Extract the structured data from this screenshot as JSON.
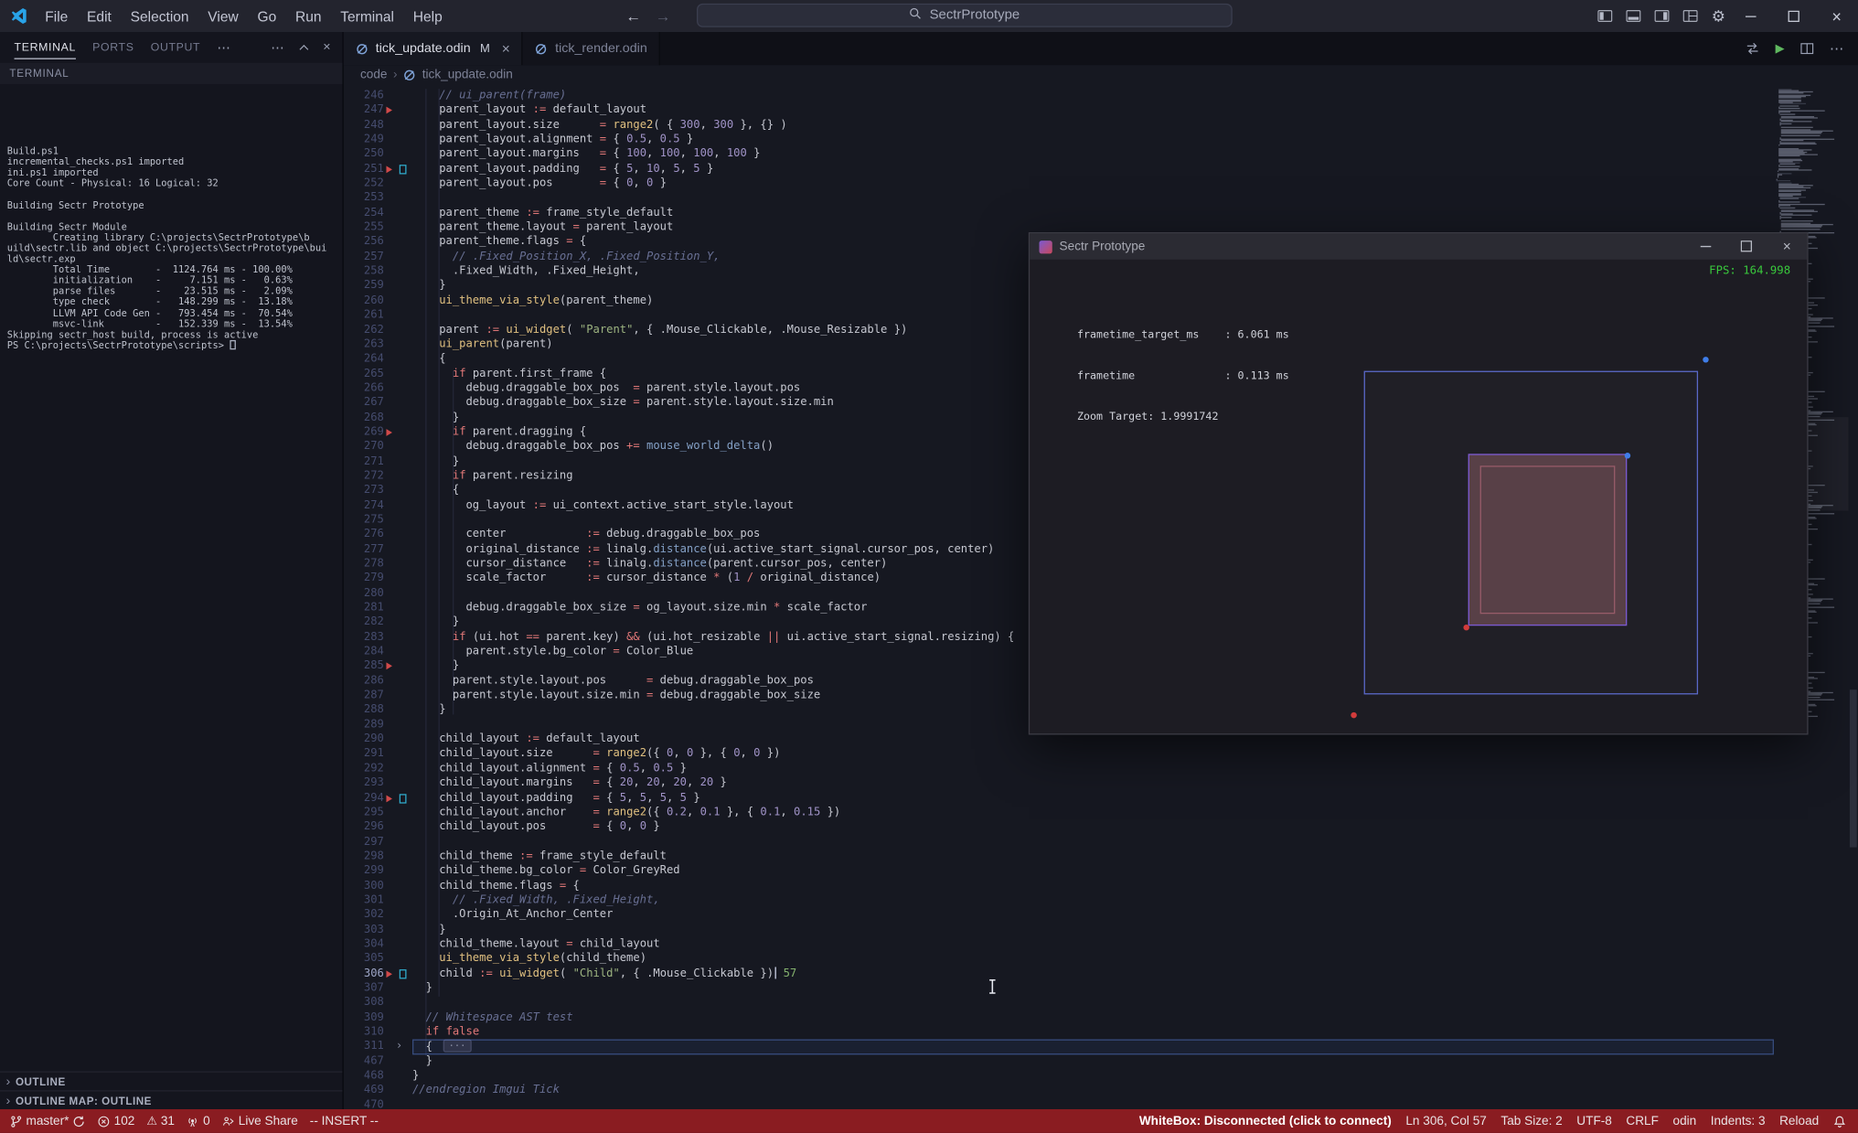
{
  "colors": {
    "editor_bg": "#161821",
    "panel_bg": "#14151e",
    "titlebar_bg": "#23242e",
    "tabbar_bg": "#0f1017",
    "statusbar_bg": "#8a1c21",
    "keyword_red": "#e27878",
    "number_purple": "#a093c7",
    "string_green": "#9cb380",
    "func_yellow": "#e0c080",
    "func_blue": "#84a0c6",
    "comment_grey": "#686f93",
    "fps_green": "#39c83c",
    "parent_border": "#5a68c8",
    "child_fill": "#584047",
    "child_border": "#7b5ad2",
    "dot_blue": "#3f7de8",
    "dot_red": "#d23b3b"
  },
  "titlebar": {
    "menus": [
      "File",
      "Edit",
      "Selection",
      "View",
      "Go",
      "Run",
      "Terminal",
      "Help"
    ],
    "back": "←",
    "forward": "→",
    "search_text": "SectrPrototype",
    "right_icons": [
      "toggle-sidebar-icon",
      "toggle-panel-icon",
      "toggle-secondary-sidebar-icon",
      "customize-layout-icon",
      "settings-gear-icon"
    ],
    "window_controls": [
      "minimize",
      "maximize",
      "close"
    ]
  },
  "panel": {
    "tabs": [
      {
        "label": "TERMINAL",
        "active": true
      },
      {
        "label": "PORTS",
        "active": false
      },
      {
        "label": "OUTPUT",
        "active": false
      }
    ],
    "tabs_overflow": "⋯",
    "header_icons": [
      "more-icon",
      "chevron-up-icon",
      "close-icon"
    ],
    "section_label": "TERMINAL",
    "terminal_lines": [
      "",
      "Build.ps1",
      "incremental_checks.ps1 imported",
      "ini.ps1 imported",
      "Core Count - Physical: 16 Logical: 32",
      "",
      "Building Sectr Prototype",
      "",
      "Building Sectr Module",
      "        Creating library C:\\projects\\SectrPrototype\\b",
      "uild\\sectr.lib and object C:\\projects\\SectrPrototype\\bui",
      "ld\\sectr.exp",
      "        Total Time        -  1124.764 ms - 100.00%",
      "        initialization    -     7.151 ms -   0.63%",
      "        parse files       -    23.515 ms -   2.09%",
      "        type check        -   148.299 ms -  13.18%",
      "        LLVM API Code Gen -   793.454 ms -  70.54%",
      "        msvc-link         -   152.339 ms -  13.54%",
      "Skipping sectr_host build, process is active"
    ],
    "prompt": "PS C:\\projects\\SectrPrototype\\scripts> ",
    "sections": [
      {
        "label": "OUTLINE"
      },
      {
        "label": "OUTLINE MAP: OUTLINE"
      }
    ]
  },
  "editor": {
    "tabs": [
      {
        "label": "tick_update.odin",
        "badge": "M",
        "active": true
      },
      {
        "label": "tick_render.odin",
        "badge": "",
        "active": false
      }
    ],
    "actions": [
      "open-changes-icon",
      "run-button",
      "split-editor-icon",
      "more-actions-icon"
    ],
    "breadcrumb": {
      "root": "code",
      "file": "tick_update.odin"
    },
    "breakpoint_lines": [
      247,
      251,
      269,
      285,
      294,
      306
    ],
    "bookmark_lines": [
      251,
      294,
      306
    ],
    "current_line": 306,
    "lines": [
      {
        "n": 246,
        "text": "    // ui_parent(frame)"
      },
      {
        "n": 247,
        "text": "    parent_layout := default_layout"
      },
      {
        "n": 248,
        "text": "    parent_layout.size      = range2( { 300, 300 }, {} )"
      },
      {
        "n": 249,
        "text": "    parent_layout.alignment = { 0.5, 0.5 }"
      },
      {
        "n": 250,
        "text": "    parent_layout.margins   = { 100, 100, 100, 100 }"
      },
      {
        "n": 251,
        "text": "    parent_layout.padding   = { 5, 10, 5, 5 }"
      },
      {
        "n": 252,
        "text": "    parent_layout.pos       = { 0, 0 }"
      },
      {
        "n": 253,
        "text": ""
      },
      {
        "n": 254,
        "text": "    parent_theme := frame_style_default"
      },
      {
        "n": 255,
        "text": "    parent_theme.layout = parent_layout"
      },
      {
        "n": 256,
        "text": "    parent_theme.flags = {"
      },
      {
        "n": 257,
        "text": "      // .Fixed_Position_X, .Fixed_Position_Y,"
      },
      {
        "n": 258,
        "text": "      .Fixed_Width, .Fixed_Height,"
      },
      {
        "n": 259,
        "text": "    }"
      },
      {
        "n": 260,
        "text": "    ui_theme_via_style(parent_theme)"
      },
      {
        "n": 261,
        "text": ""
      },
      {
        "n": 262,
        "text": "    parent := ui_widget( \"Parent\", { .Mouse_Clickable, .Mouse_Resizable })"
      },
      {
        "n": 263,
        "text": "    ui_parent(parent)"
      },
      {
        "n": 264,
        "text": "    {"
      },
      {
        "n": 265,
        "text": "      if parent.first_frame {"
      },
      {
        "n": 266,
        "text": "        debug.draggable_box_pos  = parent.style.layout.pos"
      },
      {
        "n": 267,
        "text": "        debug.draggable_box_size = parent.style.layout.size.min"
      },
      {
        "n": 268,
        "text": "      }"
      },
      {
        "n": 269,
        "text": "      if parent.dragging {"
      },
      {
        "n": 270,
        "text": "        debug.draggable_box_pos += mouse_world_delta()"
      },
      {
        "n": 271,
        "text": "      }"
      },
      {
        "n": 272,
        "text": "      if parent.resizing"
      },
      {
        "n": 273,
        "text": "      {"
      },
      {
        "n": 274,
        "text": "        og_layout := ui_context.active_start_style.layout"
      },
      {
        "n": 275,
        "text": ""
      },
      {
        "n": 276,
        "text": "        center            := debug.draggable_box_pos"
      },
      {
        "n": 277,
        "text": "        original_distance := linalg.distance(ui.active_start_signal.cursor_pos, center)"
      },
      {
        "n": 278,
        "text": "        cursor_distance   := linalg.distance(parent.cursor_pos, center)"
      },
      {
        "n": 279,
        "text": "        scale_factor      := cursor_distance * (1 / original_distance)"
      },
      {
        "n": 280,
        "text": ""
      },
      {
        "n": 281,
        "text": "        debug.draggable_box_size = og_layout.size.min * scale_factor"
      },
      {
        "n": 282,
        "text": "      }"
      },
      {
        "n": 283,
        "text": "      if (ui.hot == parent.key) && (ui.hot_resizable || ui.active_start_signal.resizing) {"
      },
      {
        "n": 284,
        "text": "        parent.style.bg_color = Color_Blue"
      },
      {
        "n": 285,
        "text": "      }"
      },
      {
        "n": 286,
        "text": "      parent.style.layout.pos      = debug.draggable_box_pos"
      },
      {
        "n": 287,
        "text": "      parent.style.layout.size.min = debug.draggable_box_size"
      },
      {
        "n": 288,
        "text": "    }"
      },
      {
        "n": 289,
        "text": ""
      },
      {
        "n": 290,
        "text": "    child_layout := default_layout"
      },
      {
        "n": 291,
        "text": "    child_layout.size      = range2({ 0, 0 }, { 0, 0 })"
      },
      {
        "n": 292,
        "text": "    child_layout.alignment = { 0.5, 0.5 }"
      },
      {
        "n": 293,
        "text": "    child_layout.margins   = { 20, 20, 20, 20 }"
      },
      {
        "n": 294,
        "text": "    child_layout.padding   = { 5, 5, 5, 5 }"
      },
      {
        "n": 295,
        "text": "    child_layout.anchor    = range2({ 0.2, 0.1 }, { 0.1, 0.15 })"
      },
      {
        "n": 296,
        "text": "    child_layout.pos       = { 0, 0 }"
      },
      {
        "n": 297,
        "text": ""
      },
      {
        "n": 298,
        "text": "    child_theme := frame_style_default"
      },
      {
        "n": 299,
        "text": "    child_theme.bg_color = Color_GreyRed"
      },
      {
        "n": 300,
        "text": "    child_theme.flags = {"
      },
      {
        "n": 301,
        "text": "      // .Fixed_Width, .Fixed_Height,"
      },
      {
        "n": 302,
        "text": "      .Origin_At_Anchor_Center"
      },
      {
        "n": 303,
        "text": "    }"
      },
      {
        "n": 304,
        "text": "    child_theme.layout = child_layout"
      },
      {
        "n": 305,
        "text": "    ui_theme_via_style(child_theme)"
      },
      {
        "n": 306,
        "text": "    child := ui_widget( \"Child\", { .Mouse_Clickable })",
        "hint": "57"
      },
      {
        "n": 307,
        "text": "  }"
      },
      {
        "n": 308,
        "text": ""
      },
      {
        "n": 309,
        "text": "  // Whitespace AST test"
      },
      {
        "n": 310,
        "text": "  if false"
      },
      {
        "n": 311,
        "text": "  { ",
        "folded": true
      },
      {
        "n": 467,
        "text": "  }"
      },
      {
        "n": 468,
        "text": "}"
      },
      {
        "n": 469,
        "text": "//endregion Imgui Tick"
      },
      {
        "n": 470,
        "text": ""
      }
    ]
  },
  "app_window": {
    "title": "Sectr Prototype",
    "controls": [
      "minimize",
      "maximize",
      "close"
    ],
    "fps_label": "FPS: 164.998",
    "stats": [
      "frametime_target_ms    : 6.061 ms",
      "frametime              : 0.113 ms",
      "Zoom Target: 1.9991742"
    ]
  },
  "statusbar": {
    "left": [
      {
        "icon": "branch-icon",
        "label": "master*",
        "suffix_icon": "sync-icon"
      },
      {
        "icon": "error-icon",
        "label": "102"
      },
      {
        "icon": "warning-icon",
        "label": "31"
      },
      {
        "icon": "radio-tower-icon",
        "label": "0"
      },
      {
        "icon": "live-share-icon",
        "label": "Live Share"
      },
      {
        "label": "-- INSERT --"
      }
    ],
    "right": [
      {
        "label": "WhiteBox: Disconnected (click to connect)",
        "emphasis": true
      },
      {
        "label": "Ln 306, Col 57"
      },
      {
        "label": "Tab Size: 2"
      },
      {
        "label": "UTF-8"
      },
      {
        "label": "CRLF"
      },
      {
        "label": "odin"
      },
      {
        "label": "Indents: 3"
      },
      {
        "label": "Reload"
      },
      {
        "icon": "bell-icon",
        "label": ""
      }
    ]
  }
}
